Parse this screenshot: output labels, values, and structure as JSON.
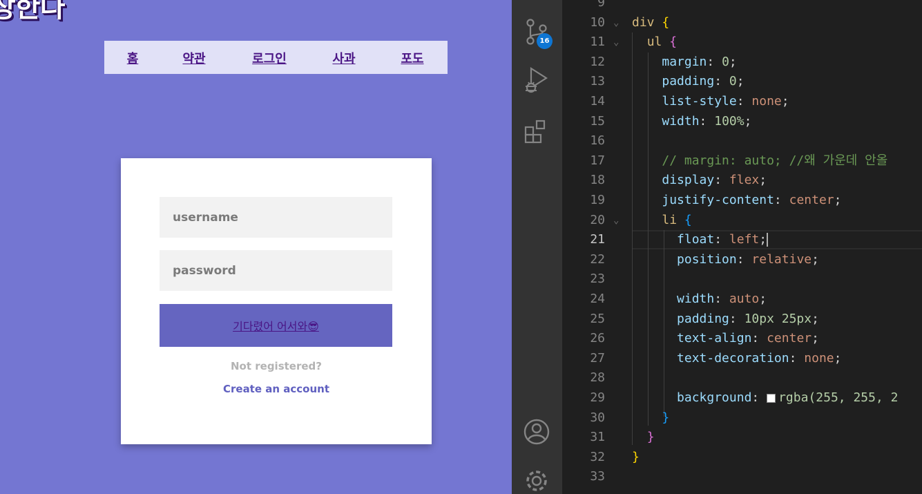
{
  "preview": {
    "site_title": "장한다",
    "nav": [
      "홈",
      "약관",
      "로그인",
      "사과",
      "포도"
    ],
    "form": {
      "username_placeholder": "username",
      "password_placeholder": "password",
      "submit_label": "기다렸어 어서와😎",
      "not_registered": "Not registered?",
      "create_account": "Create an account"
    },
    "colors": {
      "background": "#7476d2",
      "nav_bg": "#e1e1f7",
      "button": "#6565c0",
      "link": "#4a1585"
    }
  },
  "activity_bar": {
    "source_control_badge": "16",
    "icons": [
      "source-control-icon",
      "run-debug-icon",
      "extensions-icon",
      "account-icon",
      "settings-gear-icon"
    ]
  },
  "editor": {
    "lines": [
      {
        "n": "9"
      },
      {
        "n": "10"
      },
      {
        "n": "11"
      },
      {
        "n": "12"
      },
      {
        "n": "13"
      },
      {
        "n": "14"
      },
      {
        "n": "15"
      },
      {
        "n": "16"
      },
      {
        "n": "17"
      },
      {
        "n": "18"
      },
      {
        "n": "19"
      },
      {
        "n": "20"
      },
      {
        "n": "21"
      },
      {
        "n": "22"
      },
      {
        "n": "23"
      },
      {
        "n": "24"
      },
      {
        "n": "25"
      },
      {
        "n": "26"
      },
      {
        "n": "27"
      },
      {
        "n": "28"
      },
      {
        "n": "29"
      },
      {
        "n": "30"
      },
      {
        "n": "31"
      },
      {
        "n": "32"
      },
      {
        "n": "33"
      }
    ],
    "code": {
      "l10_sel": "div",
      "l10_brace": "{",
      "l11_sel": "ul",
      "l11_brace": "{",
      "l12_prop": "margin",
      "l12_val": "0",
      "l13_prop": "padding",
      "l13_val": "0",
      "l14_prop": "list-style",
      "l14_val": "none",
      "l15_prop": "width",
      "l15_val": "100%",
      "l17_comment": "// margin: auto; //왜 가운데 안올",
      "l18_prop": "display",
      "l18_val": "flex",
      "l19_prop": "justify-content",
      "l19_val": "center",
      "l20_sel": "li",
      "l20_brace": "{",
      "l21_prop": "float",
      "l21_val": "left",
      "l22_prop": "position",
      "l22_val": "relative",
      "l24_prop": "width",
      "l24_val": "auto",
      "l25_prop": "padding",
      "l25_val": "10px 25px",
      "l26_prop": "text-align",
      "l26_val": "center",
      "l27_prop": "text-decoration",
      "l27_val": "none",
      "l29_prop": "background",
      "l29_val": "rgba(255, 255, 2",
      "l30_brace": "}",
      "l31_brace": "}",
      "l32_brace": "}"
    },
    "active_line": "21"
  }
}
